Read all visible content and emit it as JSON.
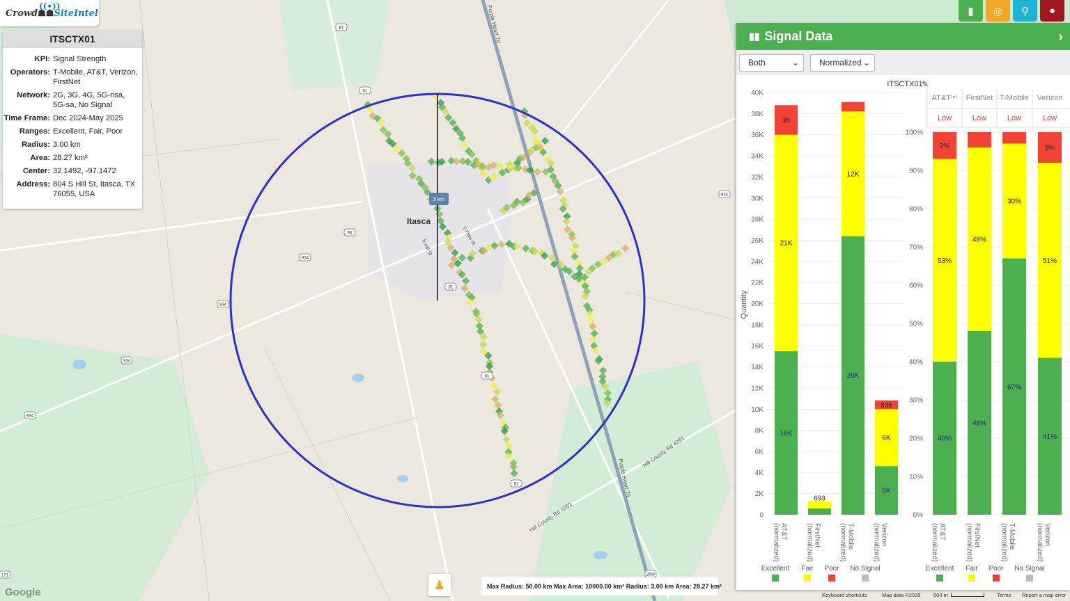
{
  "logo": {
    "part1": "Crowd",
    "part2": "SiteIntel"
  },
  "site": {
    "title": "ITSCTX01",
    "fields": [
      {
        "k": "KPI:",
        "v": "Signal Strength"
      },
      {
        "k": "Operators:",
        "v": "T-Mobile, AT&T, Verizon, FirstNet"
      },
      {
        "k": "Network:",
        "v": "2G, 3G, 4G, 5G-nsa, 5G-sa, No Signal"
      },
      {
        "k": "Time Frame:",
        "v": "Dec 2024-May 2025"
      },
      {
        "k": "Ranges:",
        "v": "Excellent, Fair, Poor"
      },
      {
        "k": "Radius:",
        "v": "3.00 km"
      },
      {
        "k": "Area:",
        "v": "28.27 km²"
      },
      {
        "k": "Center:",
        "v": "32.1492, -97.1472"
      },
      {
        "k": "Address:",
        "v": "804 S Hill St, Itasca, TX 76055, USA"
      }
    ]
  },
  "top_buttons": [
    {
      "name": "chart-icon",
      "glyph": "▮",
      "color": "#4caf50"
    },
    {
      "name": "target-icon",
      "glyph": "◎",
      "color": "#f5a623"
    },
    {
      "name": "pin-icon",
      "glyph": "⚲",
      "color": "#1fb6d6"
    },
    {
      "name": "globe-icon",
      "glyph": "●",
      "color": "#a3161d"
    }
  ],
  "map": {
    "town_label": "Itasca",
    "scale_label": "3 km",
    "road_labels": [
      "Purple Heart Trl",
      "Hill County Rd 4251",
      "Hill County Rd 4251",
      "S Hill St",
      "S Files St",
      "Purple Heart Trl"
    ],
    "shields": [
      "81",
      "81",
      "81",
      "81",
      "81",
      "934",
      "934",
      "934",
      "934",
      "934",
      "66",
      "35W",
      "171"
    ]
  },
  "panel": {
    "title": "Signal Data",
    "select1": "Both",
    "select2": "Normalized",
    "chart_label": "ITSCTX01"
  },
  "chart_data": [
    {
      "type": "bar",
      "title": "ITSCTX01",
      "ylabel": "Quantity",
      "ylim": [
        0,
        40000
      ],
      "yticks": [
        "0",
        "2K",
        "4K",
        "6K",
        "8K",
        "10K",
        "12K",
        "14K",
        "16K",
        "18K",
        "20K",
        "22K",
        "24K",
        "26K",
        "28K",
        "30K",
        "32K",
        "34K",
        "36K",
        "38K",
        "40K"
      ],
      "categories": [
        "AT&T (normalized)",
        "FirstNet (normalized)",
        "T-Mobile (normalized)",
        "Verizon (normalized)"
      ],
      "stacked": true,
      "series": [
        {
          "name": "Excellent",
          "color": "#4caf50",
          "values": [
            15500,
            600,
            26400,
            4600
          ],
          "labels": [
            "16K",
            "",
            "26K",
            "5K"
          ]
        },
        {
          "name": "Fair",
          "color": "#ffff00",
          "values": [
            20500,
            693,
            11800,
            5400
          ],
          "labels": [
            "21K",
            "693",
            "12K",
            "6K"
          ]
        },
        {
          "name": "Poor",
          "color": "#f44336",
          "values": [
            2800,
            0,
            900,
            836
          ],
          "labels": [
            "3K",
            "",
            "",
            "836"
          ]
        },
        {
          "name": "No Signal",
          "color": "#bdbdbd",
          "values": [
            0,
            0,
            0,
            0
          ],
          "labels": [
            "",
            "",
            "",
            ""
          ]
        }
      ]
    },
    {
      "type": "bar",
      "ylim": [
        0,
        100
      ],
      "yticks": [
        "0%",
        "10%",
        "20%",
        "30%",
        "40%",
        "50%",
        "60%",
        "70%",
        "80%",
        "90%",
        "100%"
      ],
      "columns": [
        "AT&T⁽ⁿ⁾",
        "FirstNet",
        "T-Mobile",
        "Verizon"
      ],
      "levels": [
        "Low",
        "Low",
        "Low",
        "Low"
      ],
      "categories": [
        "AT&T (normalized)",
        "FirstNet (normalized)",
        "T-Mobile (normalized)",
        "Verizon (normalized)"
      ],
      "stacked": true,
      "series": [
        {
          "name": "Excellent",
          "color": "#4caf50",
          "values": [
            40,
            48,
            67,
            41
          ],
          "labels": [
            "40%",
            "48%",
            "67%",
            "41%"
          ]
        },
        {
          "name": "Fair",
          "color": "#ffff00",
          "values": [
            53,
            48,
            30,
            51
          ],
          "labels": [
            "53%",
            "48%",
            "30%",
            "51%"
          ]
        },
        {
          "name": "Poor",
          "color": "#f44336",
          "values": [
            7,
            4,
            3,
            8
          ],
          "labels": [
            "7%",
            "",
            "",
            "8%"
          ]
        },
        {
          "name": "No Signal",
          "color": "#bdbdbd",
          "values": [
            0,
            0,
            0,
            0
          ],
          "labels": [
            "",
            "",
            "",
            ""
          ]
        }
      ]
    }
  ],
  "legend": [
    "Excellent",
    "Fair",
    "Poor",
    "No Signal"
  ],
  "footer": {
    "max_info": "Max Radius: 50.00 km Max Area: 10000.00 km² Radius: 3.00 km Area: 28.27 km²",
    "keyboard": "Keyboard shortcuts",
    "mapdata": "Map data ©2025",
    "scale": "500 m",
    "terms": "Terms",
    "report": "Report a map error",
    "google": "Google"
  }
}
